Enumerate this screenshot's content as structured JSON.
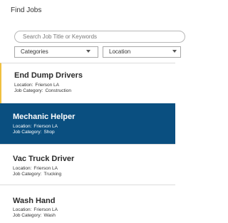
{
  "header": {
    "title": "Find Jobs"
  },
  "filters": {
    "search_placeholder": "Search Job Title or Keywords",
    "category_label": "Categories",
    "location_label": "Location"
  },
  "labels": {
    "location": "Location:",
    "category": "Job Category:"
  },
  "jobs": [
    {
      "title": "End Dump Drivers",
      "location": "Frierson LA",
      "category": "Construction"
    },
    {
      "title": "Mechanic Helper",
      "location": "Frierson LA",
      "category": "Shop"
    },
    {
      "title": "Vac Truck Driver",
      "location": "Frierson LA",
      "category": "Trucking"
    },
    {
      "title": "Wash Hand",
      "location": "Frierson LA",
      "category": "Wash"
    }
  ],
  "colors": {
    "selected_bg": "#0a4f80",
    "accent": "#f0c040"
  }
}
